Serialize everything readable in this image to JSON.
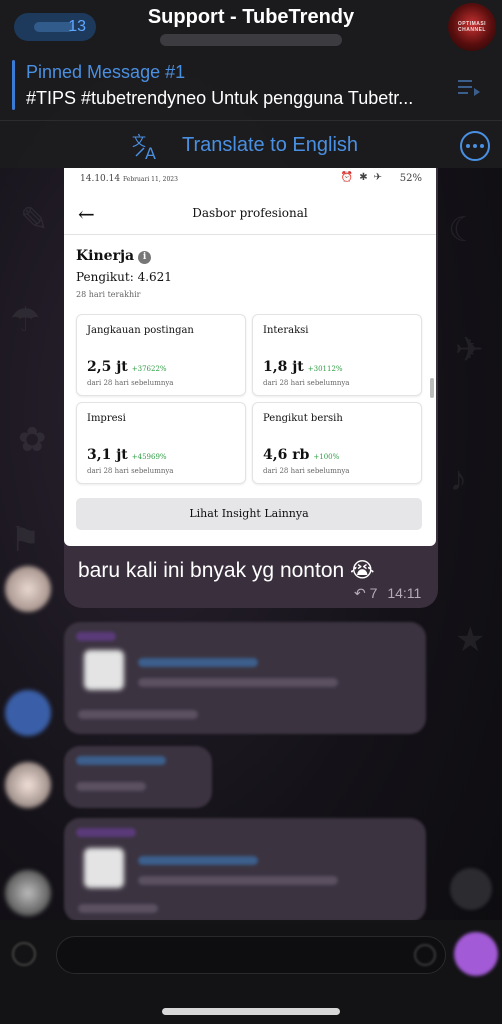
{
  "header": {
    "back_count": "13",
    "title": "Support - TubeTrendy",
    "channel_avatar": {
      "line1": "OPTIMASI",
      "line2": "CHANNEL"
    },
    "pinned": {
      "label": "Pinned Message #1",
      "text": "#TIPS #tubetrendyneo Untuk pengguna Tubetr..."
    },
    "translate_label": "Translate to English"
  },
  "screenshot": {
    "status": {
      "time": "14.10.14",
      "date": "Februari 11, 2023",
      "battery": "52%"
    },
    "page_title": "Dasbor profesional",
    "section_title": "Kinerja",
    "followers": "Pengikut: 4.621",
    "period": "28 hari terakhir",
    "cards": [
      {
        "label": "Jangkauan postingan",
        "value": "2,5 jt",
        "delta": "+37622%",
        "sub": "dari 28 hari sebelumnya"
      },
      {
        "label": "Interaksi",
        "value": "1,8 jt",
        "delta": "+30112%",
        "sub": "dari 28 hari sebelumnya"
      },
      {
        "label": "Impresi",
        "value": "3,1 jt",
        "delta": "+45969%",
        "sub": "dari 28 hari sebelumnya"
      },
      {
        "label": "Pengikut bersih",
        "value": "4,6 rb",
        "delta": "+100%",
        "sub": "dari 28 hari sebelumnya"
      }
    ],
    "insight_button": "Lihat Insight Lainnya"
  },
  "message": {
    "text": "baru kali ini bnyak yg nonton 😭",
    "replies": "7",
    "time": "14:11"
  },
  "colors": {
    "accent": "#4a90e2",
    "bubble": "#3a2f3d",
    "positive": "#2e9e44",
    "mic": "#a25ad6"
  }
}
